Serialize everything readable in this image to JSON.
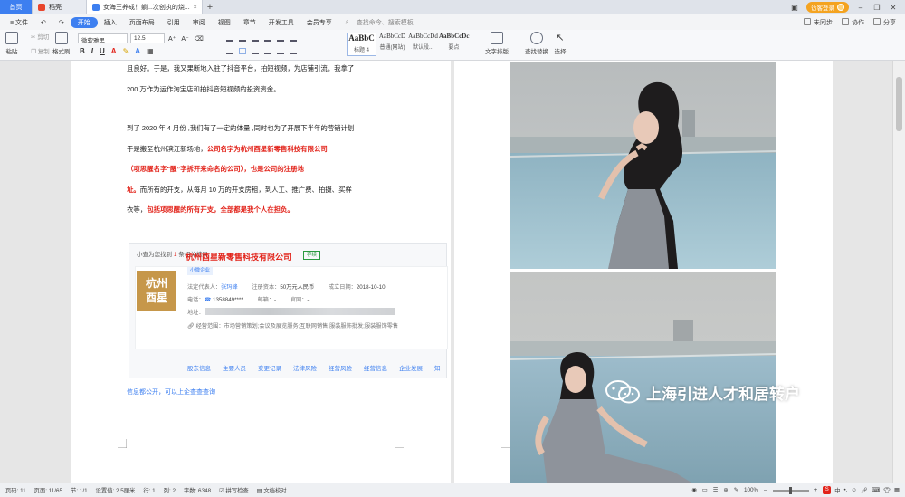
{
  "tabs": {
    "home": "首页",
    "t2": "稻壳",
    "t3": "女海王养成！躺...次创执的烧...",
    "plus": "+"
  },
  "top_right": {
    "login": "访客登录",
    "min": "–",
    "max": "❐",
    "close": "✕"
  },
  "menu": {
    "file": "≡ 文件",
    "items": [
      "开始",
      "插入",
      "页面布局",
      "引用",
      "审阅",
      "视图",
      "章节",
      "开发工具",
      "会员专享"
    ],
    "search": "查找命令、搜索模板",
    "right": [
      "未同步",
      "协作",
      "分享"
    ]
  },
  "ribbon": {
    "paste": "粘贴",
    "cut": "剪切",
    "copy": "复制",
    "format_painter": "格式刷",
    "font_name": "微软雅黑",
    "font_size": "12.5",
    "bold": "B",
    "italic": "I",
    "underline": "U",
    "styles": [
      {
        "sample": "AaBbC",
        "label": "标题 4"
      },
      {
        "sample": "AaBbCcD",
        "label": "普通(网站)"
      },
      {
        "sample": "AaBbCcDd",
        "label": "默认段..."
      },
      {
        "sample": "AaBbCcDc",
        "label": "要点"
      }
    ],
    "text_layout": "文字排版",
    "find_replace": "查找替换",
    "select": "选择"
  },
  "doc": {
    "p1": [
      "且良好。于是，我又果断地入驻了抖音平台，拍短视频，为店铺引流。我拿了",
      "200 万作为运作淘宝店和拍抖音短视频的投资资金。"
    ],
    "p2_l1": "到了 2020 年 4 月份 ,我们有了一定的体量 ,同时也为了开展下半年的营销计划 ,",
    "p2_l2a": "于是搬至杭州滨江新场地，",
    "p2_l2b": "公司名字为杭州酉星新零售科技有限公司",
    "p2_l3": "（项思醒名字“醒”字拆开来命名的公司），也是公司的注册地",
    "p2_l4a": "址。",
    "p2_l4b": "而所有的开支，从每月 10 万的开支房租，到人工、推广费、拍摄、买样",
    "p2_l5a": "衣等，",
    "p2_l5b": "包括项思醒的所有开支，全部都是我个人在担负。",
    "card": {
      "head_prefix": "小查为您找到",
      "head_count": "1",
      "head_suffix": "条相关结果",
      "logo_l1": "杭州",
      "logo_l2": "酉星",
      "name": "杭州酉星新零售科技有限公司",
      "status": "存续",
      "tag": "小微企业",
      "legal_label": "法定代表人：",
      "legal_value": "张玛峰",
      "capital_label": "注册资本：",
      "capital_value": "50万元人民币",
      "date_label": "成立日期：",
      "date_value": "2018-10-10",
      "phone_label": "电话：",
      "phone_value": "1358849****",
      "email_label": "邮箱：",
      "email_value": "-",
      "web_label": "官网：",
      "web_value": "-",
      "addr_label": "地址：",
      "scope_label": "经营范围：",
      "scope_value": "市场营销策划;会议及展览服务;互联网销售;服装服饰批发;服装服饰零售",
      "tabs": [
        "股东信息",
        "主要人员",
        "变更记录",
        "法律风险",
        "经营风险",
        "经营信息",
        "企业发展",
        "知"
      ]
    },
    "footer_link": "信息都公开，可以上企查查查询"
  },
  "watermark": "上海引进人才和居转户",
  "status": {
    "items": [
      "页码: 11",
      "页面: 11/65",
      "节: 1/1",
      "设置值: 2.5厘米",
      "行: 1",
      "列: 2",
      "字数: 6348",
      "拼写检查",
      "文档校对"
    ],
    "zoom": "100%",
    "tray_s": "S",
    "tray_lang": "中"
  }
}
